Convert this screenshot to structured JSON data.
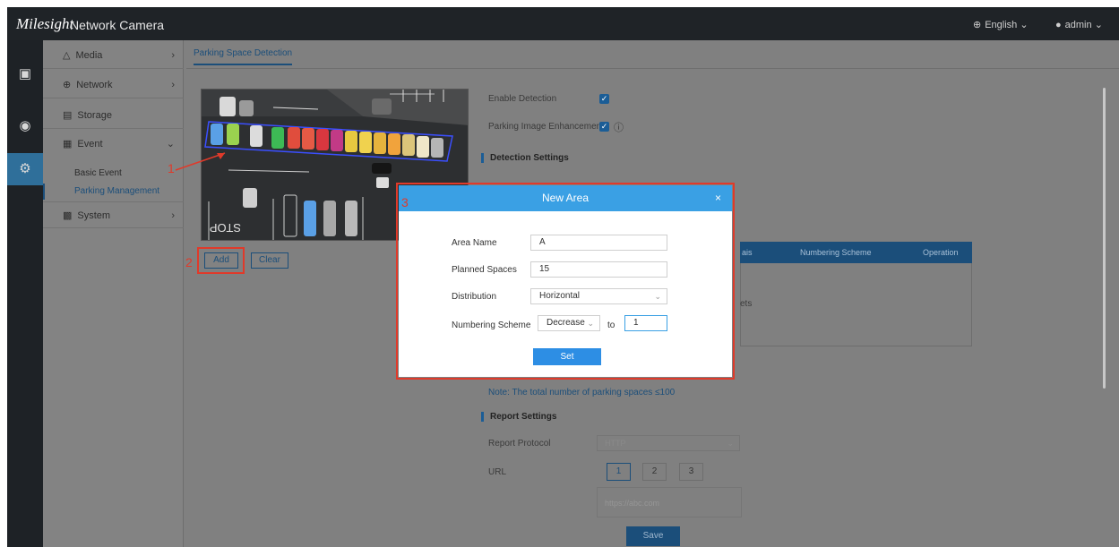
{
  "header": {
    "logo": "Milesight",
    "subtitle": "Network Camera",
    "language": "English",
    "user": "admin"
  },
  "rail": {
    "items": [
      "live-view",
      "playback",
      "settings"
    ]
  },
  "nav": {
    "items": [
      {
        "label": "Media"
      },
      {
        "label": "Network"
      },
      {
        "label": "Storage"
      },
      {
        "label": "Event"
      },
      {
        "label": "System"
      }
    ],
    "sub_items": [
      {
        "label": "Basic Event"
      },
      {
        "label": "Parking Management"
      }
    ]
  },
  "tab": {
    "label": "Parking Space Detection"
  },
  "preview": {
    "stop_text": "STOP"
  },
  "actions": {
    "add_label": "Add",
    "clear_label": "Clear"
  },
  "annotations": {
    "one": "1",
    "two": "2",
    "three": "3"
  },
  "options": {
    "enable_detection": "Enable Detection",
    "enhancement": "Parking Image Enhancement",
    "detection_settings": "Detection Settings"
  },
  "table": {
    "col_partial": "ais",
    "col_numbering": "Numbering Scheme",
    "col_operation": "Operation",
    "cell_partial": "ets"
  },
  "note": "Note: The total number of parking spaces ≤100",
  "report": {
    "title": "Report Settings",
    "protocol_label": "Report Protocol",
    "protocol_value": "HTTP",
    "url_label": "URL",
    "url_tabs": [
      "1",
      "2",
      "3"
    ],
    "url_placeholder": "https://abc.com",
    "save_label": "Save"
  },
  "modal": {
    "title": "New Area",
    "close": "×",
    "area_name_label": "Area Name",
    "area_name_value": "A",
    "planned_label": "Planned Spaces",
    "planned_value": "15",
    "distribution_label": "Distribution",
    "distribution_value": "Horizontal",
    "numbering_label": "Numbering Scheme",
    "numbering_value": "Decrease",
    "to_label": "to",
    "start_value": "1",
    "set_label": "Set"
  }
}
